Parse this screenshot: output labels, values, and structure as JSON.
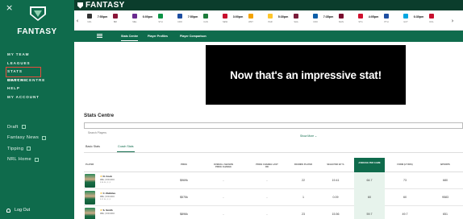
{
  "sidebar": {
    "brand": "FANTASY",
    "close_glyph": "×",
    "menu": [
      "MY TEAM",
      "LEAGUES",
      "STATS CENTRE",
      "MATCH CENTRE",
      "HELP",
      "MY ACCOUNT"
    ],
    "links": [
      "Draft",
      "Fantasy News",
      "Tipping",
      "NRL Home"
    ],
    "logout": "Log Out"
  },
  "topbar": {
    "title": "FANTASY"
  },
  "fixtures": {
    "times": [
      "7:50pm",
      "6:00pm",
      "7:50pm",
      "3:00pm",
      "5:30pm",
      "7:35pm",
      "4:05pm",
      "6:30pm"
    ],
    "abbr": [
      "NZL",
      "BRI",
      "MEL",
      "STH",
      "CRO",
      "CAN",
      "NEW",
      "WST",
      "PAR",
      "SHA",
      "CRO",
      "MAN",
      "STG",
      "PTH",
      "GCT",
      "DOL"
    ],
    "colors": [
      "#333333",
      "#8a1538",
      "#6a2b90",
      "#0b9446",
      "#1d4ea1",
      "#1d7c3a",
      "#c8102e",
      "#f4a300",
      "#ffc72c",
      "#7a1d3a",
      "#0b5ea8",
      "#7a0c2e",
      "#d0102e",
      "#1d4ea1",
      "#00a7e1",
      "#c8102e"
    ]
  },
  "subnav": {
    "tabs": [
      "Stats Centre",
      "Player Profiles",
      "Player Comparison"
    ]
  },
  "banner": {
    "text": "Now that's an impressive stat!"
  },
  "stats": {
    "title": "Stats Centre",
    "search_placeholder": "Search Players",
    "show_more": "Show More ⌄",
    "tabs": [
      "Basic Stats",
      "Coach Stats"
    ],
    "columns": [
      "PLAYER",
      "PRICE",
      "OVERALL SEASON PRICE CHANGE",
      "PRICE CHANGE LAST RD",
      "ROUNDS PLAYED",
      "SELECTED BY %",
      "AVERAGE PER GAME",
      "FORM (LT RDS)",
      "$/POINTS"
    ],
    "rows": [
      {
        "name": "N. Cook",
        "sub": "RBU | SYD ROO",
        "sub2": "$ 94.3k  |  3  |  3",
        "price": "$969k",
        "season": "-",
        "last": "-",
        "rounds": "22",
        "selected": "19.41",
        "avg": "64.7",
        "form": "73",
        "pts": "680"
      },
      {
        "name": "C. Rubbles",
        "sub": "RBU | SYD ROO",
        "sub2": "$ 57.5k  |  3  |  3",
        "price": "$575k",
        "season": "-",
        "last": "-",
        "rounds": "1",
        "selected": "0.09",
        "avg": "60",
        "form": "60",
        "pts": "9583"
      },
      {
        "name": "S. Smith",
        "sub": "RBU | SYD ROO",
        "sub2": "",
        "price": "$896k",
        "season": "-",
        "last": "-",
        "rounds": "23",
        "selected": "15.56",
        "avg": "59.7",
        "form": "49.7",
        "pts": "651"
      }
    ]
  },
  "colors": {
    "primary": "#0f6b4c",
    "dark": "#0b3d2c",
    "highlight": "#e84c3d"
  }
}
